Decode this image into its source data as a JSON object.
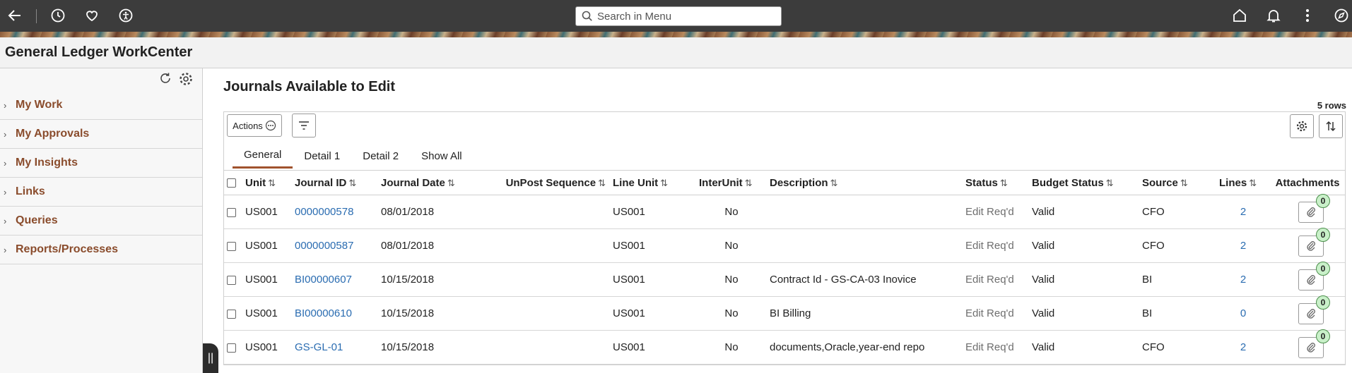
{
  "topbar": {
    "search_placeholder": "Search in Menu"
  },
  "page_title": "General Ledger WorkCenter",
  "sidebar": {
    "items": [
      {
        "label": "My Work"
      },
      {
        "label": "My Approvals"
      },
      {
        "label": "My Insights"
      },
      {
        "label": "Links"
      },
      {
        "label": "Queries"
      },
      {
        "label": "Reports/Processes"
      }
    ]
  },
  "main": {
    "title": "Journals Available to Edit",
    "row_count": "5 rows",
    "actions_label": "Actions",
    "tabs": [
      {
        "label": "General",
        "active": true
      },
      {
        "label": "Detail 1",
        "active": false
      },
      {
        "label": "Detail 2",
        "active": false
      },
      {
        "label": "Show All",
        "active": false
      }
    ],
    "columns": [
      "Unit",
      "Journal ID",
      "Journal Date",
      "UnPost Sequence",
      "Line Unit",
      "InterUnit",
      "Description",
      "Status",
      "Budget Status",
      "Source",
      "Lines",
      "Attachments"
    ],
    "rows": [
      {
        "unit": "US001",
        "journal_id": "0000000578",
        "journal_date": "08/01/2018",
        "unpost_seq": "",
        "line_unit": "US001",
        "interunit": "No",
        "description": "",
        "status": "Edit Req'd",
        "budget_status": "Valid",
        "source": "CFO",
        "lines": "2",
        "attachments": "0"
      },
      {
        "unit": "US001",
        "journal_id": "0000000587",
        "journal_date": "08/01/2018",
        "unpost_seq": "",
        "line_unit": "US001",
        "interunit": "No",
        "description": "",
        "status": "Edit Req'd",
        "budget_status": "Valid",
        "source": "CFO",
        "lines": "2",
        "attachments": "0"
      },
      {
        "unit": "US001",
        "journal_id": "BI00000607",
        "journal_date": "10/15/2018",
        "unpost_seq": "",
        "line_unit": "US001",
        "interunit": "No",
        "description": "Contract Id - GS-CA-03 Inovice",
        "status": "Edit Req'd",
        "budget_status": "Valid",
        "source": "BI",
        "lines": "2",
        "attachments": "0"
      },
      {
        "unit": "US001",
        "journal_id": "BI00000610",
        "journal_date": "10/15/2018",
        "unpost_seq": "",
        "line_unit": "US001",
        "interunit": "No",
        "description": "BI Billing",
        "status": "Edit Req'd",
        "budget_status": "Valid",
        "source": "BI",
        "lines": "0",
        "attachments": "0"
      },
      {
        "unit": "US001",
        "journal_id": "GS-GL-01",
        "journal_date": "10/15/2018",
        "unpost_seq": "",
        "line_unit": "US001",
        "interunit": "No",
        "description": "documents,Oracle,year-end repo",
        "status": "Edit Req'd",
        "budget_status": "Valid",
        "source": "CFO",
        "lines": "2",
        "attachments": "0"
      }
    ]
  }
}
